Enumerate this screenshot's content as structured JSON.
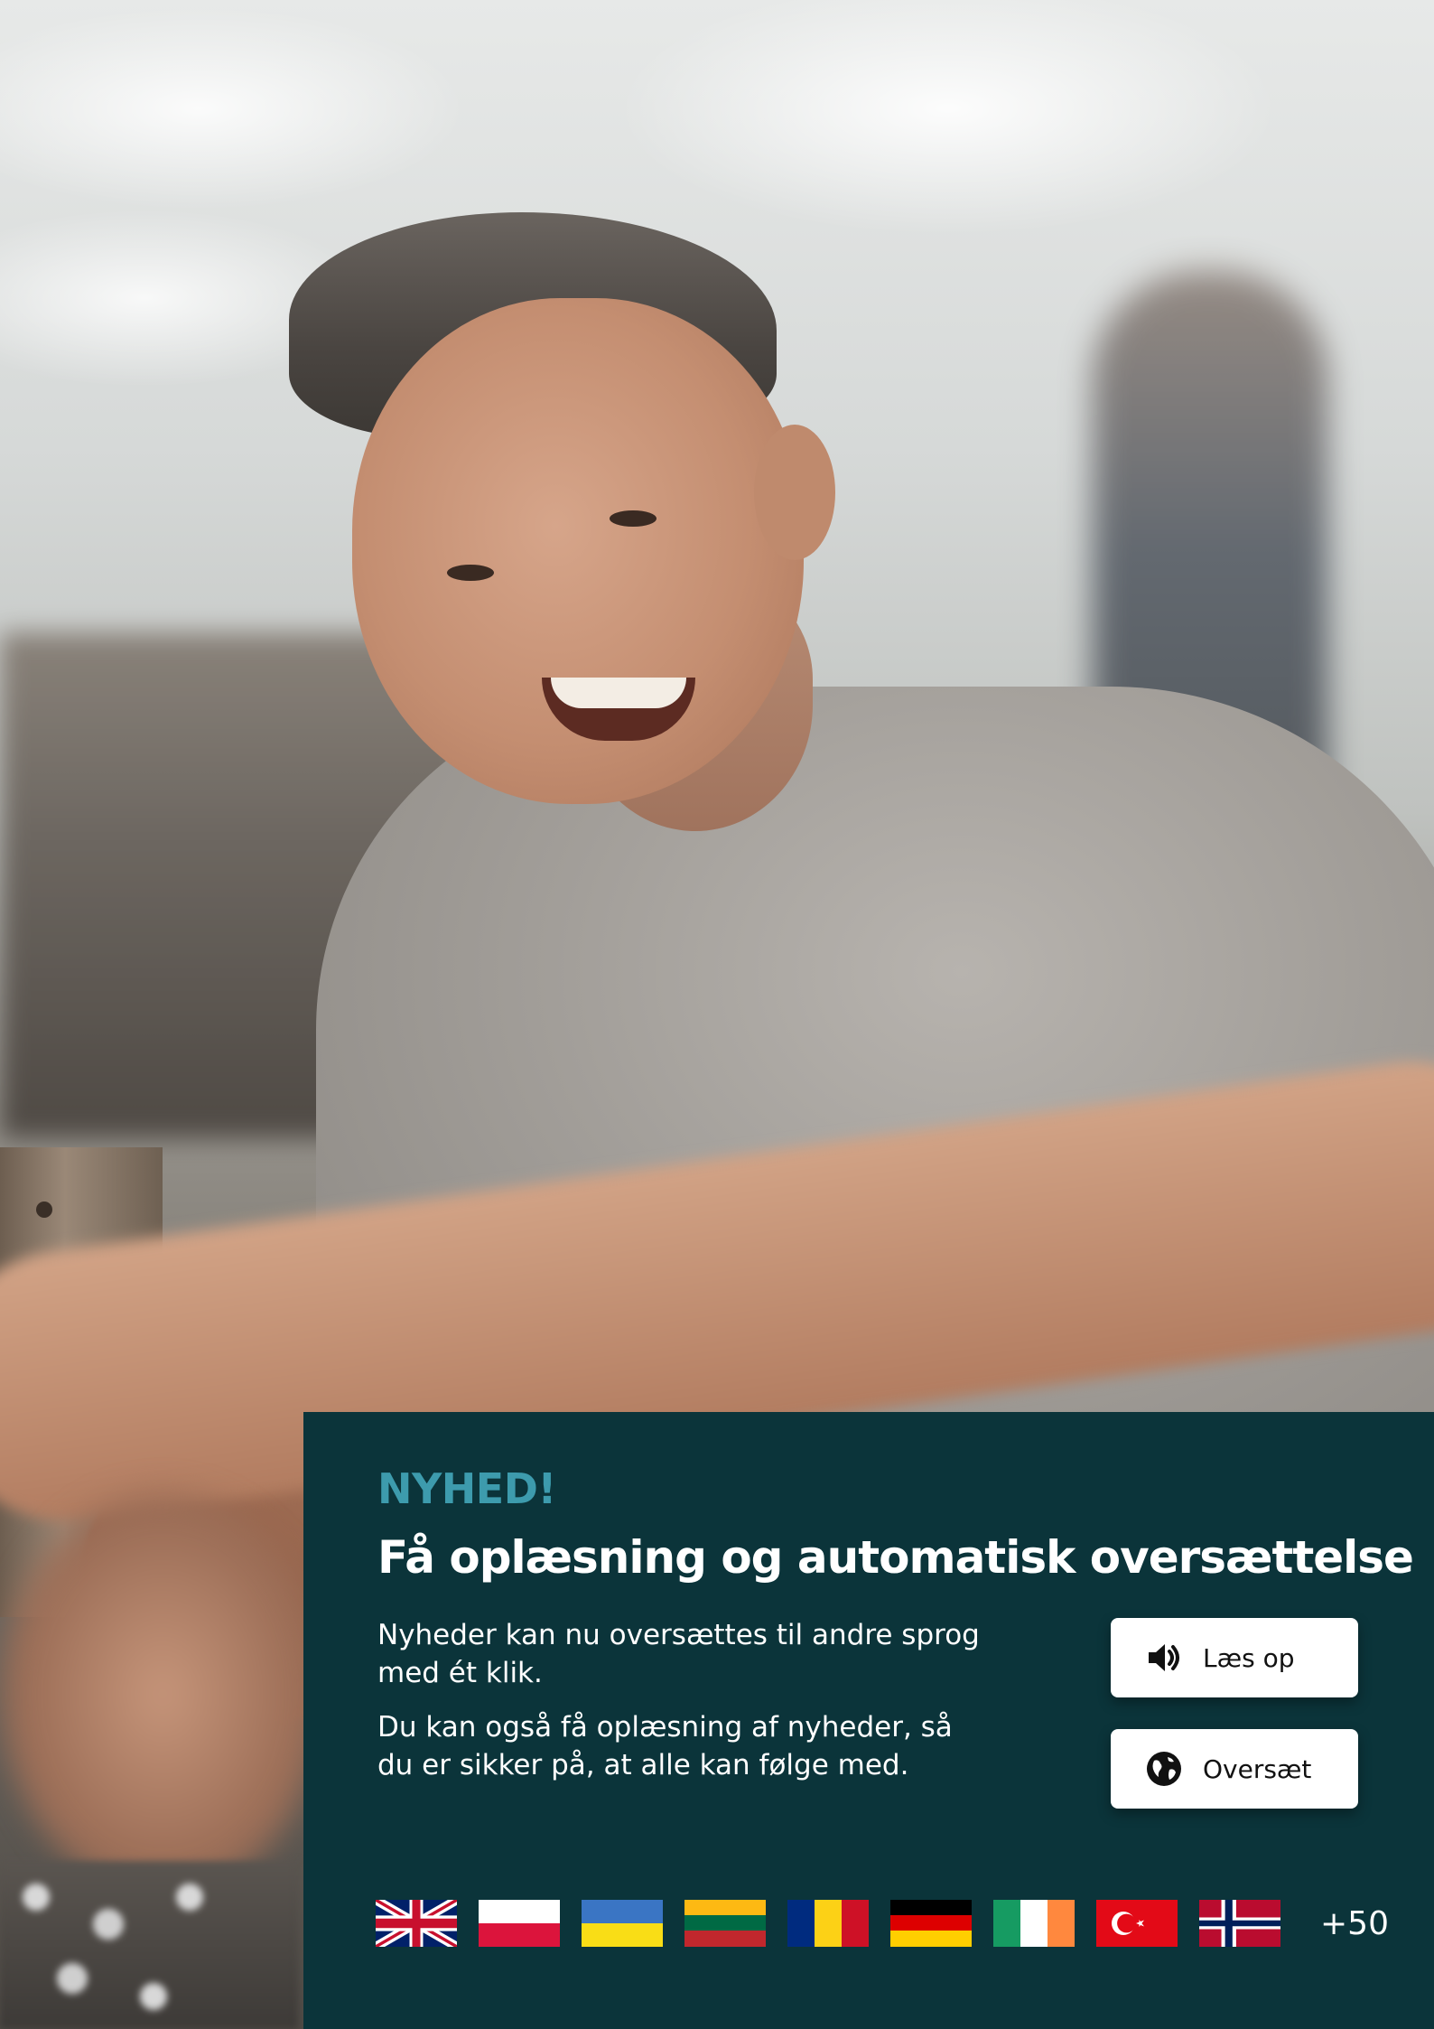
{
  "panel": {
    "badge": "NYHED!",
    "title": "Få oplæsning og automatisk oversættelse",
    "paragraphs": [
      "Nyheder kan nu oversættes til andre sprog med ét klik.",
      "Du kan også få oplæsning af nyheder, så du er sikker på, at alle kan følge med."
    ],
    "buttons": {
      "read_aloud": {
        "label": "Læs op",
        "icon": "speaker-icon"
      },
      "translate": {
        "label": "Oversæt",
        "icon": "globe-icon"
      }
    },
    "languages": {
      "flags": [
        "uk-flag",
        "poland-flag",
        "ukraine-flag",
        "lithuania-flag",
        "romania-flag",
        "germany-flag",
        "ireland-flag",
        "turkey-flag",
        "norway-flag"
      ],
      "more_label": "+50"
    }
  },
  "colors": {
    "panel_bg": "#0b343a",
    "badge": "#3d9bad",
    "text": "#ffffff",
    "button_bg": "#ffffff"
  }
}
